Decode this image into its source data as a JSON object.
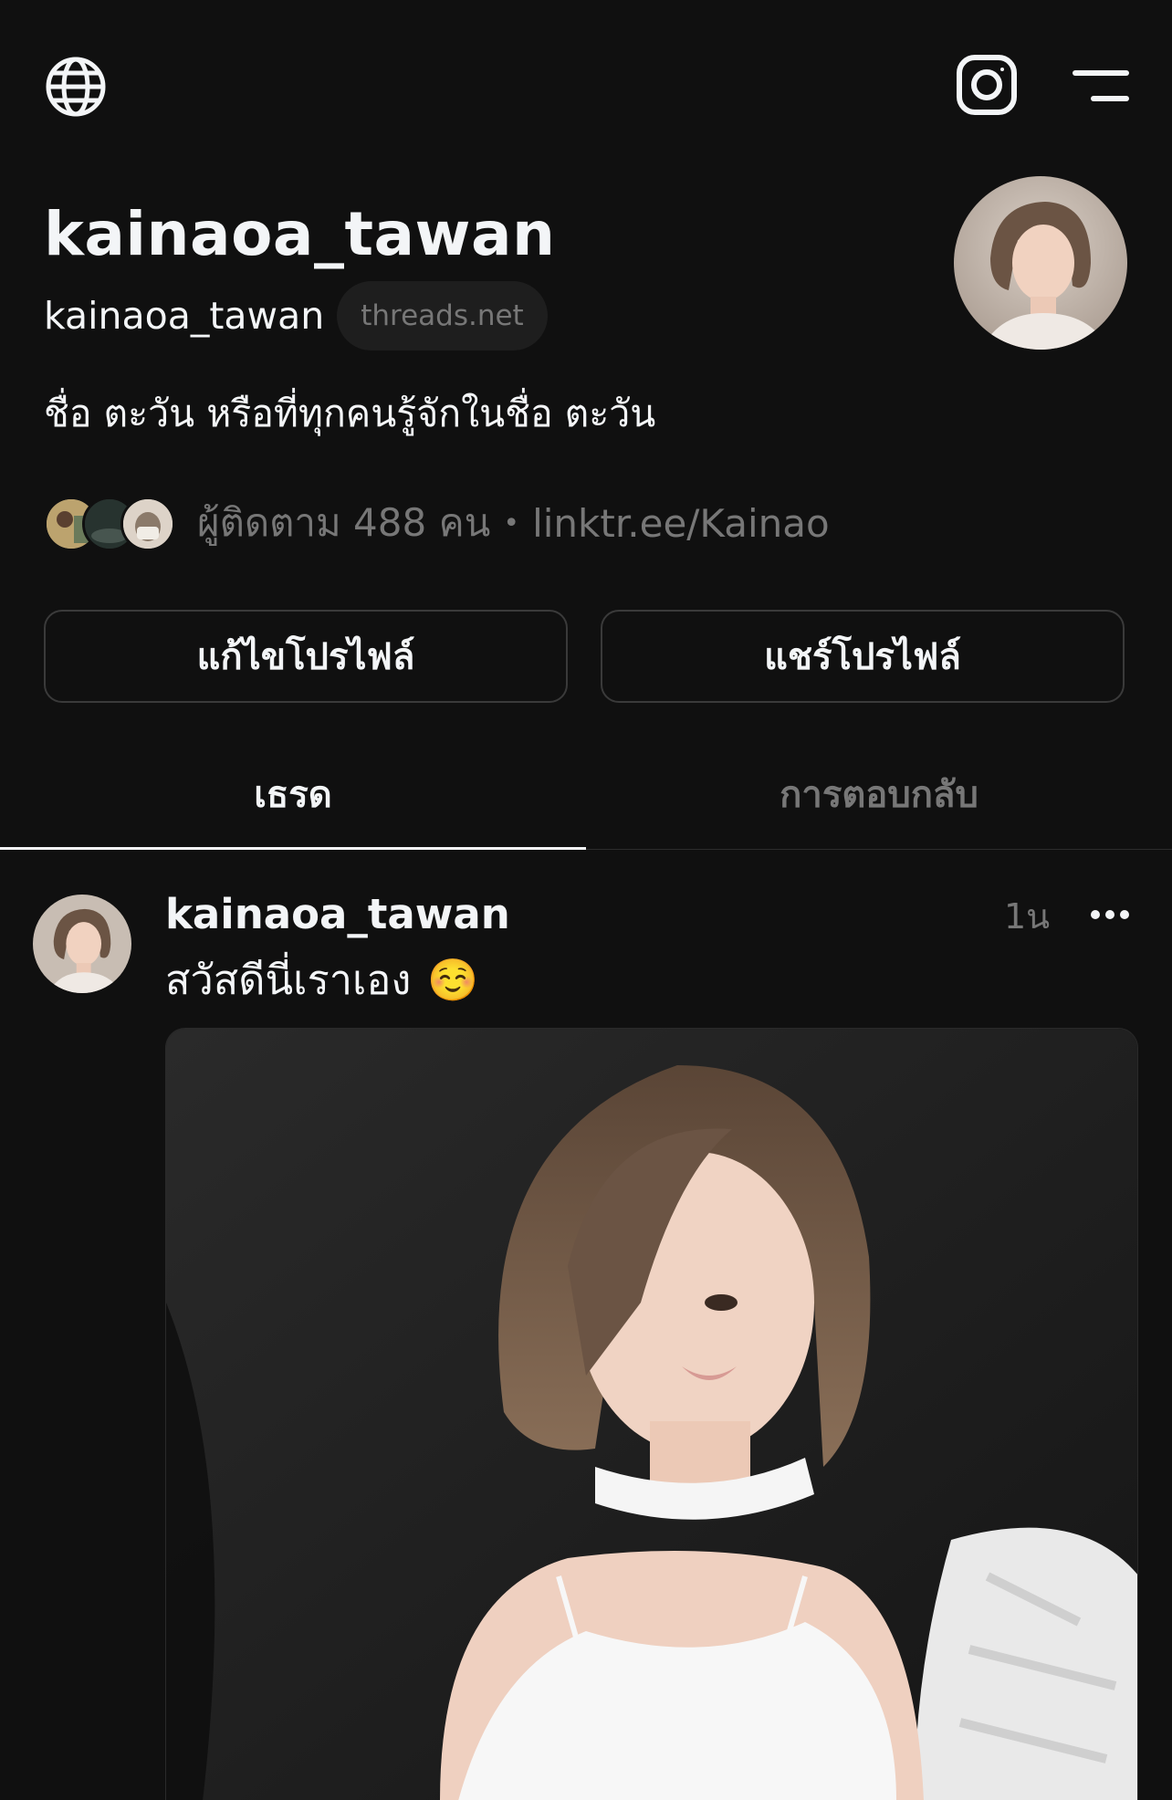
{
  "header": {
    "globe_icon": "globe-icon",
    "instagram_icon": "instagram-icon",
    "menu_icon": "menu-icon"
  },
  "profile": {
    "display_name": "kainaoa_tawan",
    "handle": "kainaoa_tawan",
    "domain_badge": "threads.net",
    "bio": "ชื่อ ตะวัน หรือที่ทุกคนรู้จักในชื่อ ตะวัน",
    "followers_text": "ผู้ติดตาม 488 คน",
    "separator": "•",
    "link": "linktr.ee/Kainao"
  },
  "actions": {
    "edit_profile": "แก้ไขโปรไฟล์",
    "share_profile": "แชร์โปรไฟล์"
  },
  "tabs": [
    {
      "label": "เธรด",
      "active": true
    },
    {
      "label": "การตอบกลับ",
      "active": false
    }
  ],
  "post": {
    "author": "kainaoa_tawan",
    "time": "1น",
    "text": "สวัสดีนี่เราเอง",
    "emoji": "☺️"
  },
  "colors": {
    "background": "#101010",
    "text_primary": "#f3f5f7",
    "text_secondary": "#777777",
    "border": "#3a3a3a"
  }
}
